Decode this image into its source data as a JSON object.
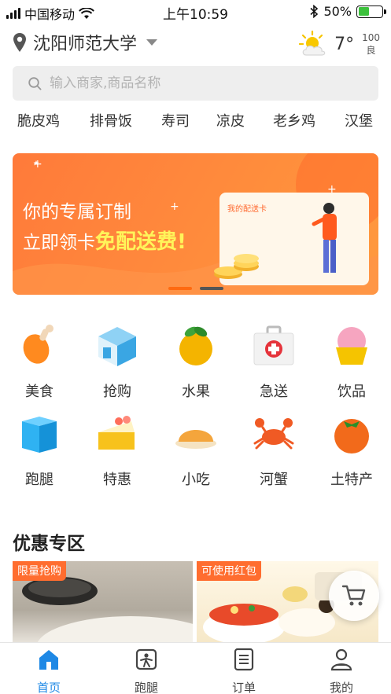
{
  "status_bar": {
    "carrier": "中国移动",
    "time": "上午10:59",
    "battery_percent": "50%",
    "battery_level": 0.5
  },
  "header": {
    "location": "沈阳师范大学",
    "temperature": "7°",
    "aqi_value": "100",
    "aqi_level": "良",
    "weather_icon": "partly-sunny-icon"
  },
  "search": {
    "placeholder": "输入商家,商品名称"
  },
  "quick_tags": [
    "脆皮鸡",
    "排骨饭",
    "寿司",
    "凉皮",
    "老乡鸡",
    "汉堡"
  ],
  "banner": {
    "line1": "你的专属订制",
    "line2_prefix": "立即领卡",
    "line2_highlight": "免配送费!",
    "card_label": "我的配送卡",
    "active_slide": 1,
    "slide_count": 2
  },
  "categories": [
    {
      "label": "美食",
      "icon": "drumstick-icon"
    },
    {
      "label": "抢购",
      "icon": "shop-icon"
    },
    {
      "label": "水果",
      "icon": "orange-icon"
    },
    {
      "label": "急送",
      "icon": "medical-kit-icon"
    },
    {
      "label": "饮品",
      "icon": "dessert-cup-icon"
    },
    {
      "label": "跑腿",
      "icon": "box-icon"
    },
    {
      "label": "特惠",
      "icon": "cake-slice-icon"
    },
    {
      "label": "小吃",
      "icon": "bun-icon"
    },
    {
      "label": "河蟹",
      "icon": "crab-icon"
    },
    {
      "label": "土特产",
      "icon": "tomato-icon"
    }
  ],
  "deals": {
    "title": "优惠专区",
    "items": [
      {
        "badge": "限量抢购"
      },
      {
        "badge": "可使用红包"
      }
    ]
  },
  "bottom_nav": [
    {
      "label": "首页",
      "icon": "home-icon",
      "active": true
    },
    {
      "label": "跑腿",
      "icon": "errand-icon",
      "active": false
    },
    {
      "label": "订单",
      "icon": "order-list-icon",
      "active": false
    },
    {
      "label": "我的",
      "icon": "profile-icon",
      "active": false
    }
  ],
  "colors": {
    "accent": "#1e88e5",
    "banner_orange": "#ff7a3a",
    "badge": "#ff6d2f",
    "highlight": "#fff45a"
  }
}
